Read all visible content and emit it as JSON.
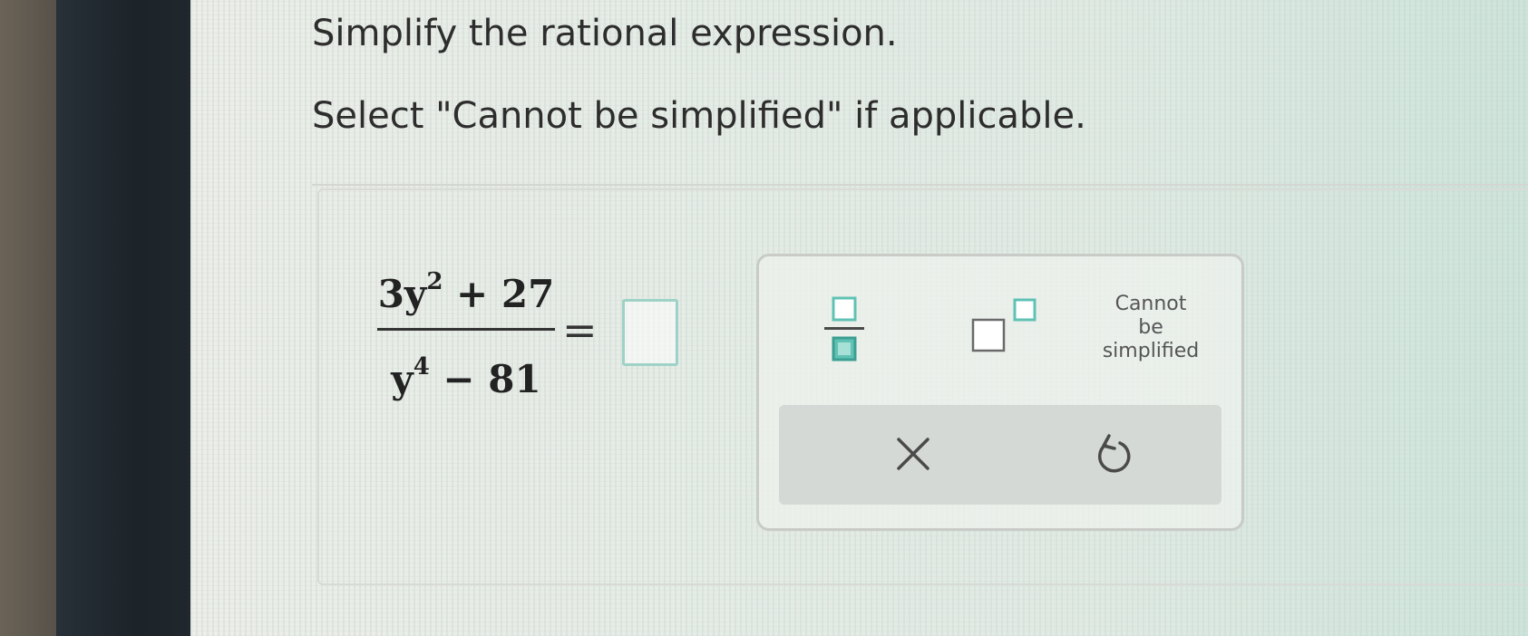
{
  "question": {
    "prompt_line_1": "Simplify the rational expression.",
    "prompt_line_2": "Select \"Cannot be simplified\" if applicable."
  },
  "expression": {
    "numerator_coefficient": "3y",
    "numerator_exponent": "2",
    "numerator_rest": "+ 27",
    "denominator_base": "y",
    "denominator_exponent": "4",
    "denominator_rest": "− 81",
    "equals": "="
  },
  "answer": {
    "value": ""
  },
  "palette": {
    "fraction_icon": "fraction-icon",
    "exponent_icon": "exponent-icon",
    "cannot_simplify_line_1": "Cannot",
    "cannot_simplify_line_2": "be",
    "cannot_simplify_line_3": "simplified",
    "clear_icon": "x-icon",
    "undo_icon": "undo-icon"
  },
  "colors": {
    "accent_box": "#9fd2c6",
    "fraction_fill": "#5fc2b4",
    "text": "#2d2d2d"
  }
}
